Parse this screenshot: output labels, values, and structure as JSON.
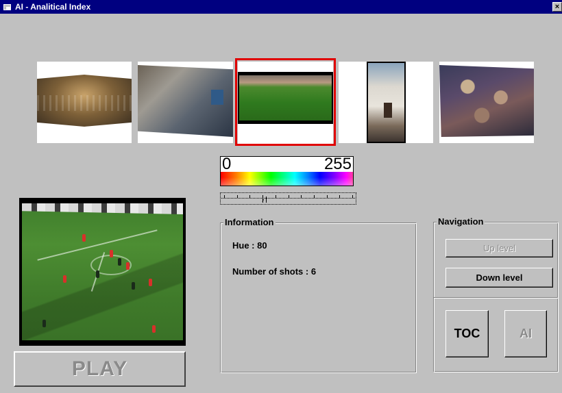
{
  "window": {
    "title": "AI - Analitical Index",
    "close_label": "×"
  },
  "thumbnails": [
    {
      "name": "parliament-shot",
      "selected": false
    },
    {
      "name": "street-shot",
      "selected": false
    },
    {
      "name": "stadium-shot",
      "selected": true
    },
    {
      "name": "church-tower-shot",
      "selected": false
    },
    {
      "name": "crowd-shot",
      "selected": false
    }
  ],
  "color_scale": {
    "min_label": "0",
    "max_label": "255"
  },
  "hue_slider": {
    "min": 0,
    "max": 255,
    "value": 80
  },
  "player": {
    "play_label": "PLAY",
    "play_enabled": false
  },
  "information": {
    "group_label": "Information",
    "hue_text": "Hue :  80",
    "shots_text": "Number of shots :  6"
  },
  "navigation": {
    "group_label": "Navigation",
    "up_level_label": "Up level",
    "up_level_enabled": false,
    "down_level_label": "Down level",
    "toc_label": "TOC",
    "ai_label": "AI",
    "ai_enabled": false
  },
  "colors": {
    "titlebar": "#000080",
    "window_bg": "#c0c0c0",
    "selection_border": "#e00000"
  }
}
